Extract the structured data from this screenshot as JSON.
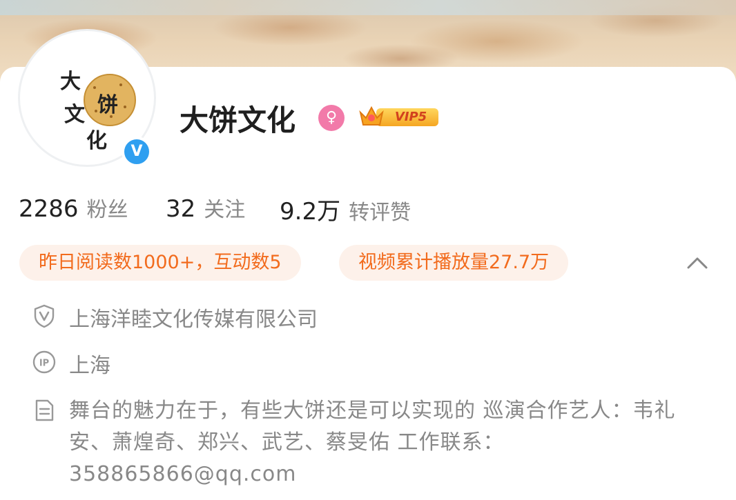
{
  "profile": {
    "name": "大饼文化",
    "avatar_chars": [
      "大",
      "文",
      "饼",
      "化"
    ],
    "verified_mark": "V",
    "gender_symbol": "♀",
    "vip_label": "VIP5"
  },
  "stats": [
    {
      "num": "2286",
      "label": "粉丝"
    },
    {
      "num": "32",
      "label": "关注"
    },
    {
      "num": "9.2万",
      "label": "转评赞"
    }
  ],
  "highlights": [
    "昨日阅读数1000+，互动数5",
    "视频累计播放量27.7万"
  ],
  "info": {
    "company": "上海洋睦文化传媒有限公司",
    "ip_location": "上海",
    "bio": "舞台的魅力在于，有些大饼还是可以实现的   巡演合作艺人：韦礼安、萧煌奇、郑兴、武艺、蔡旻佑  工作联系：358865866@qq.com"
  },
  "icons": {
    "verify": "verified-badge-icon",
    "gender": "female-icon",
    "vip": "crown-icon",
    "collapse": "chevron-up-icon",
    "company": "shield-v-icon",
    "ip": "ip-location-icon",
    "bio": "document-icon"
  },
  "colors": {
    "accent_orange": "#f26b1d",
    "pill_bg": "#fdf1ea",
    "verify_blue": "#2f9ff0",
    "gender_pink": "#f27aa9",
    "muted_text": "#888888"
  }
}
